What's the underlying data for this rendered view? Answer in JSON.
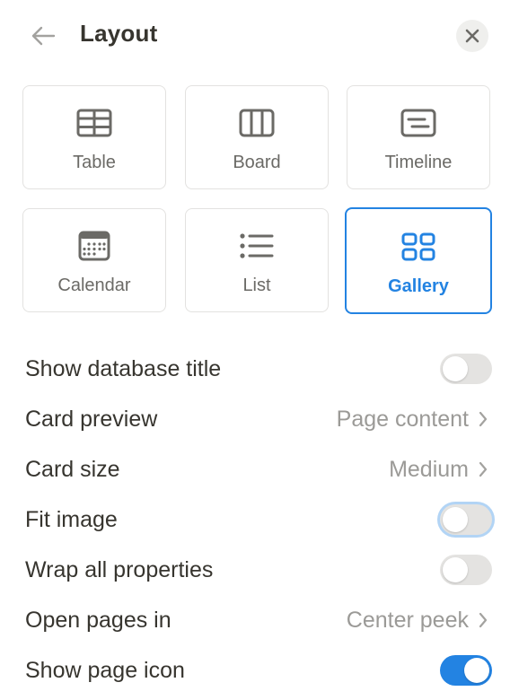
{
  "header": {
    "title": "Layout"
  },
  "layouts": [
    {
      "label": "Table",
      "icon": "table-icon"
    },
    {
      "label": "Board",
      "icon": "board-icon"
    },
    {
      "label": "Timeline",
      "icon": "timeline-icon"
    },
    {
      "label": "Calendar",
      "icon": "calendar-icon"
    },
    {
      "label": "List",
      "icon": "list-icon"
    },
    {
      "label": "Gallery",
      "icon": "gallery-icon",
      "selected": true
    }
  ],
  "settings": {
    "show_database_title": {
      "label": "Show database title",
      "on": false
    },
    "card_preview": {
      "label": "Card preview",
      "value": "Page content"
    },
    "card_size": {
      "label": "Card size",
      "value": "Medium"
    },
    "fit_image": {
      "label": "Fit image",
      "on": false
    },
    "wrap_all_properties": {
      "label": "Wrap all properties",
      "on": false
    },
    "open_pages_in": {
      "label": "Open pages in",
      "value": "Center peek"
    },
    "show_page_icon": {
      "label": "Show page icon",
      "on": true
    }
  },
  "colors": {
    "accent": "#2383e2",
    "text": "#37352f",
    "muted": "#9b9a97"
  }
}
